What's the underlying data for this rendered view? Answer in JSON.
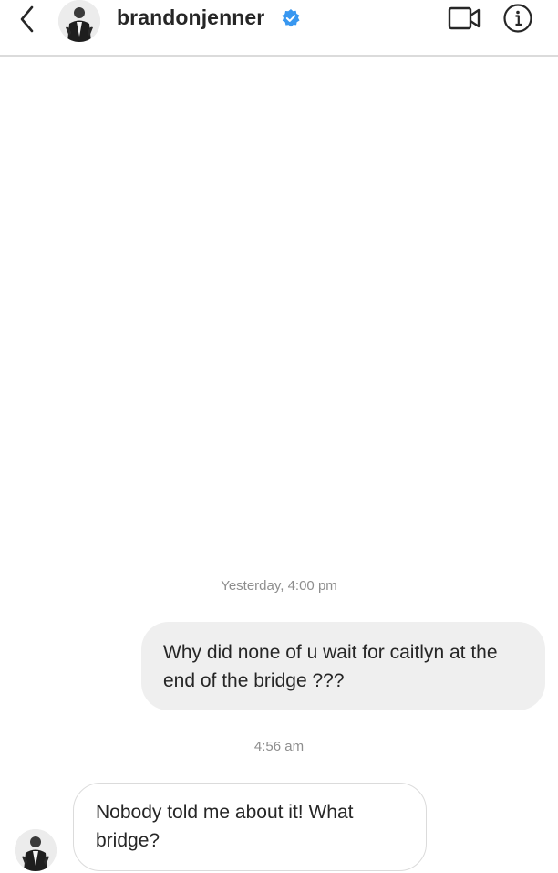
{
  "header": {
    "username": "brandonjenner",
    "verified": true,
    "icons": {
      "back": "chevron-left-icon",
      "video": "video-camera-icon",
      "info": "info-icon",
      "verified": "verified-badge-icon"
    },
    "accent_color": "#3897f0"
  },
  "thread": {
    "messages": [
      {
        "timestamp": "Yesterday, 4:00 pm",
        "direction": "outgoing",
        "text": "Why did none of u wait for caitlyn at the end of the bridge ???"
      },
      {
        "timestamp": "4:56 am",
        "direction": "incoming",
        "text": "Nobody told me about it! What bridge?"
      }
    ]
  },
  "colors": {
    "outgoing_bubble": "#efefef",
    "incoming_border": "#dbdbdb",
    "timestamp_text": "#8e8e8e"
  }
}
